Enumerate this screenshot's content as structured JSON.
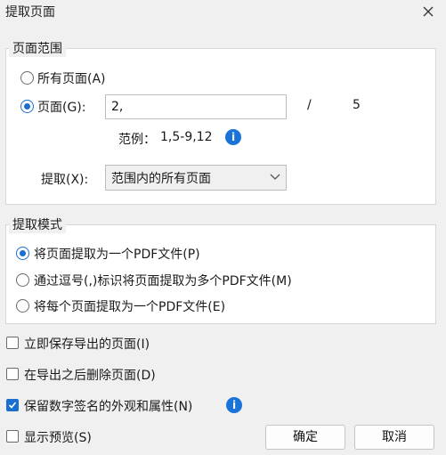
{
  "window": {
    "title": "提取页面",
    "close_icon": "close-icon"
  },
  "page_range": {
    "group_label": "页面范围",
    "all_pages_label": "所有页面(A)",
    "all_pages_checked": false,
    "pages_label": "页面(G):",
    "pages_checked": true,
    "pages_value": "2,",
    "slash": "/",
    "total_pages": "5",
    "example_label": "范例：",
    "example_value": "1,5-9,12",
    "extract_label": "提取(X):",
    "extract_value": "范围内的所有页面"
  },
  "extract_mode": {
    "group_label": "提取模式",
    "options": [
      {
        "label": "将页面提取为一个PDF文件(P)",
        "checked": true
      },
      {
        "label": "通过逗号(,)标识将页面提取为多个PDF文件(M)",
        "checked": false
      },
      {
        "label": "将每个页面提取为一个PDF文件(E)",
        "checked": false
      }
    ]
  },
  "options": {
    "save_now": {
      "label": "立即保存导出的页面(I)",
      "checked": false
    },
    "delete_after": {
      "label": "在导出之后删除页面(D)",
      "checked": false
    },
    "keep_signature": {
      "label": "保留数字签名的外观和属性(N)",
      "checked": true
    },
    "show_preview": {
      "label": "显示预览(S)",
      "checked": false
    }
  },
  "buttons": {
    "ok": "确定",
    "cancel": "取消"
  },
  "colors": {
    "accent": "#1a6fd0",
    "info": "#1a73d9",
    "dialog_bg": "#f0f0f0",
    "panel_bg": "#ffffff"
  }
}
